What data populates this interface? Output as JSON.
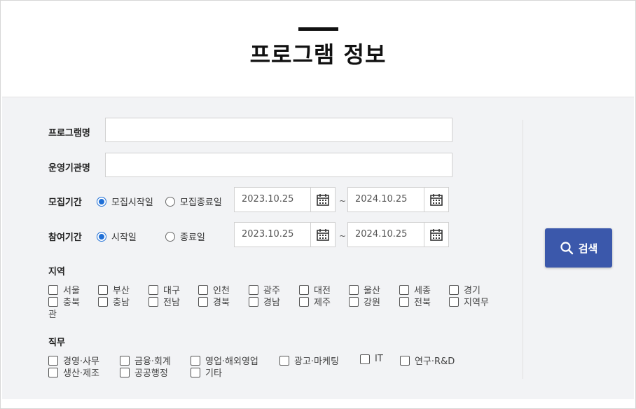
{
  "page": {
    "title": "프로그램 정보"
  },
  "form": {
    "program_name_label": "프로그램명",
    "program_name_value": "",
    "agency_label": "운영기관명",
    "agency_value": "",
    "recruit": {
      "label": "모집기간",
      "opt_start": "모집시작일",
      "opt_end": "모집종료일",
      "selected": "모집시작일",
      "date_from": "2023.10.25",
      "date_to": "2024.10.25"
    },
    "join": {
      "label": "참여기간",
      "opt_start": "시작일",
      "opt_end": "종료일",
      "selected": "시작일",
      "date_from": "2023.10.25",
      "date_to": "2024.10.25"
    },
    "tilde": "~",
    "region": {
      "label": "지역",
      "items": [
        "서울",
        "부산",
        "대구",
        "인천",
        "광주",
        "대전",
        "울산",
        "세종",
        "경기",
        "충북",
        "충남",
        "전남",
        "경북",
        "경남",
        "제주",
        "강원",
        "전북",
        "지역무"
      ],
      "wrap_tail": "관"
    },
    "job": {
      "label": "직무",
      "items": [
        "경영·사무",
        "금융·회계",
        "영업·해외영업",
        "광고·마케팅",
        "IT",
        "연구·R&D",
        "생산·제조",
        "공공행정",
        "기타"
      ]
    },
    "search_label": "검색"
  },
  "icons": {
    "calendar": "calendar-icon",
    "search": "search-icon"
  },
  "colors": {
    "accent": "#3b58ab",
    "radio": "#1f6fd6",
    "panel": "#f2f3f5"
  }
}
